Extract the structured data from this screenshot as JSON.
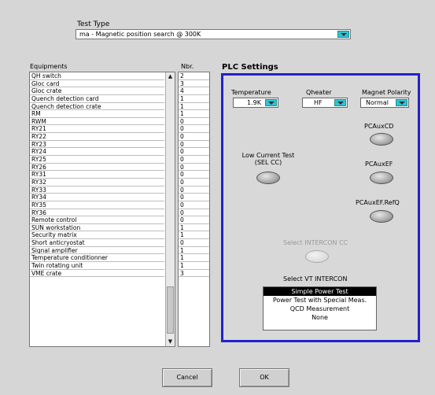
{
  "test_type": {
    "label": "Test Type",
    "value": "ma - Magnetic position search @ 300K"
  },
  "equipments": {
    "header": "Equipments",
    "nbr_header": "Nbr.",
    "rows": [
      {
        "name": "QH switch",
        "nbr": "2"
      },
      {
        "name": "Gloc card",
        "nbr": "3"
      },
      {
        "name": "Gloc crate",
        "nbr": "4"
      },
      {
        "name": "Quench detection card",
        "nbr": "1"
      },
      {
        "name": "Quench detection crate",
        "nbr": "1"
      },
      {
        "name": "RM",
        "nbr": "1"
      },
      {
        "name": "RWM",
        "nbr": "0"
      },
      {
        "name": "RY21",
        "nbr": "0"
      },
      {
        "name": "RY22",
        "nbr": "0"
      },
      {
        "name": "RY23",
        "nbr": "0"
      },
      {
        "name": "RY24",
        "nbr": "0"
      },
      {
        "name": "RY25",
        "nbr": "0"
      },
      {
        "name": "RY26",
        "nbr": "0"
      },
      {
        "name": "RY31",
        "nbr": "0"
      },
      {
        "name": "RY32",
        "nbr": "0"
      },
      {
        "name": "RY33",
        "nbr": "0"
      },
      {
        "name": "RY34",
        "nbr": "0"
      },
      {
        "name": "RY35",
        "nbr": "0"
      },
      {
        "name": "RY36",
        "nbr": "0"
      },
      {
        "name": "Remote control",
        "nbr": "0"
      },
      {
        "name": "SUN workstation",
        "nbr": "1"
      },
      {
        "name": "Security matrix",
        "nbr": "1"
      },
      {
        "name": "Short anticryostat",
        "nbr": "0"
      },
      {
        "name": "Signal amplifier",
        "nbr": "1"
      },
      {
        "name": "Temperature conditionner",
        "nbr": "1"
      },
      {
        "name": "Twin rotating unit",
        "nbr": "1"
      },
      {
        "name": "VME crate",
        "nbr": "3"
      }
    ]
  },
  "plc": {
    "title": "PLC Settings",
    "temperature": {
      "label": "Temperature",
      "value": "1.9K"
    },
    "qheater": {
      "label": "Qheater",
      "value": "HF"
    },
    "magnet_polarity": {
      "label": "Magnet Polarity",
      "value": "Normal"
    },
    "pcauxcd": "PCAuxCD",
    "low_current_test": {
      "line1": "Low Current Test",
      "line2": "(SEL CC)"
    },
    "pcauxef": "PCAuxEF",
    "pcauxef_refq": "PCAuxEF.RefQ",
    "select_intercon_cc": "Select INTERCON CC",
    "select_vt_intercon": "Select VT INTERCON",
    "vt_options": [
      "Simple Power Test",
      "Power Test with Special Meas.",
      "QCD Measurement",
      "None"
    ],
    "vt_selected": "Simple Power Test"
  },
  "buttons": {
    "cancel": "Cancel",
    "ok": "OK"
  },
  "colors": {
    "panel_border": "#2222cc",
    "combo_button": "#2ec4d4",
    "background": "#d6d6d6"
  }
}
